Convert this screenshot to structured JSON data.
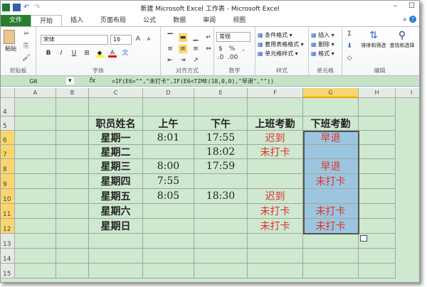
{
  "window": {
    "title": "新建 Microsoft Excel 工作表 - Microsoft Excel"
  },
  "tabs": [
    "文件",
    "开始",
    "插入",
    "页面布局",
    "公式",
    "数据",
    "审阅",
    "视图"
  ],
  "ribbon": {
    "clipboard": {
      "paste": "粘贴",
      "label": "剪贴板"
    },
    "font": {
      "name": "宋体",
      "size": "16",
      "label": "字体",
      "bold": "B",
      "italic": "I",
      "underline": "U"
    },
    "alignment": {
      "label": "对齐方式"
    },
    "number": {
      "format": "常规",
      "percent": "%",
      "label": "数字"
    },
    "styles": {
      "items": [
        "条件格式",
        "套用表格格式",
        "单元格样式"
      ],
      "label": "样式"
    },
    "cells": {
      "items": [
        "插入",
        "删除",
        "格式"
      ],
      "label": "单元格"
    },
    "editing": {
      "sort": "排序和筛选",
      "find": "查找和选择",
      "label": "编辑",
      "sum": "Σ"
    }
  },
  "formula_bar": {
    "name_box": "G6",
    "fx": "fx",
    "formula": "=IF(E6=\"\",\"未打卡\",IF(E6<TIME(18,0,0),\"早退\",\"\"))"
  },
  "columns": [
    "A",
    "B",
    "C",
    "D",
    "E",
    "F",
    "G",
    "H",
    "I"
  ],
  "rows": [
    "4",
    "5",
    "6",
    "7",
    "8",
    "9",
    "10",
    "11",
    "12",
    "13",
    "14",
    "15"
  ],
  "table": {
    "headers": [
      "职员姓名",
      "上午",
      "下午",
      "上班考勤",
      "下班考勤"
    ],
    "data": [
      [
        "星期一",
        "8:01",
        "17:55",
        "迟到",
        "早退"
      ],
      [
        "星期二",
        "",
        "18:02",
        "未打卡",
        ""
      ],
      [
        "星期三",
        "8:00",
        "17:59",
        "",
        "早退"
      ],
      [
        "星期四",
        "7:55",
        "",
        "",
        "未打卡"
      ],
      [
        "星期五",
        "8:05",
        "18:30",
        "迟到",
        ""
      ],
      [
        "星期六",
        "",
        "",
        "未打卡",
        "未打卡"
      ],
      [
        "星期日",
        "",
        "",
        "未打卡",
        "未打卡"
      ]
    ]
  },
  "colors": {
    "grid_bg": "#cfe8d0",
    "selected": "#9cc6df",
    "red_text": "#e0302a",
    "file_tab": "#2a7d2e"
  }
}
